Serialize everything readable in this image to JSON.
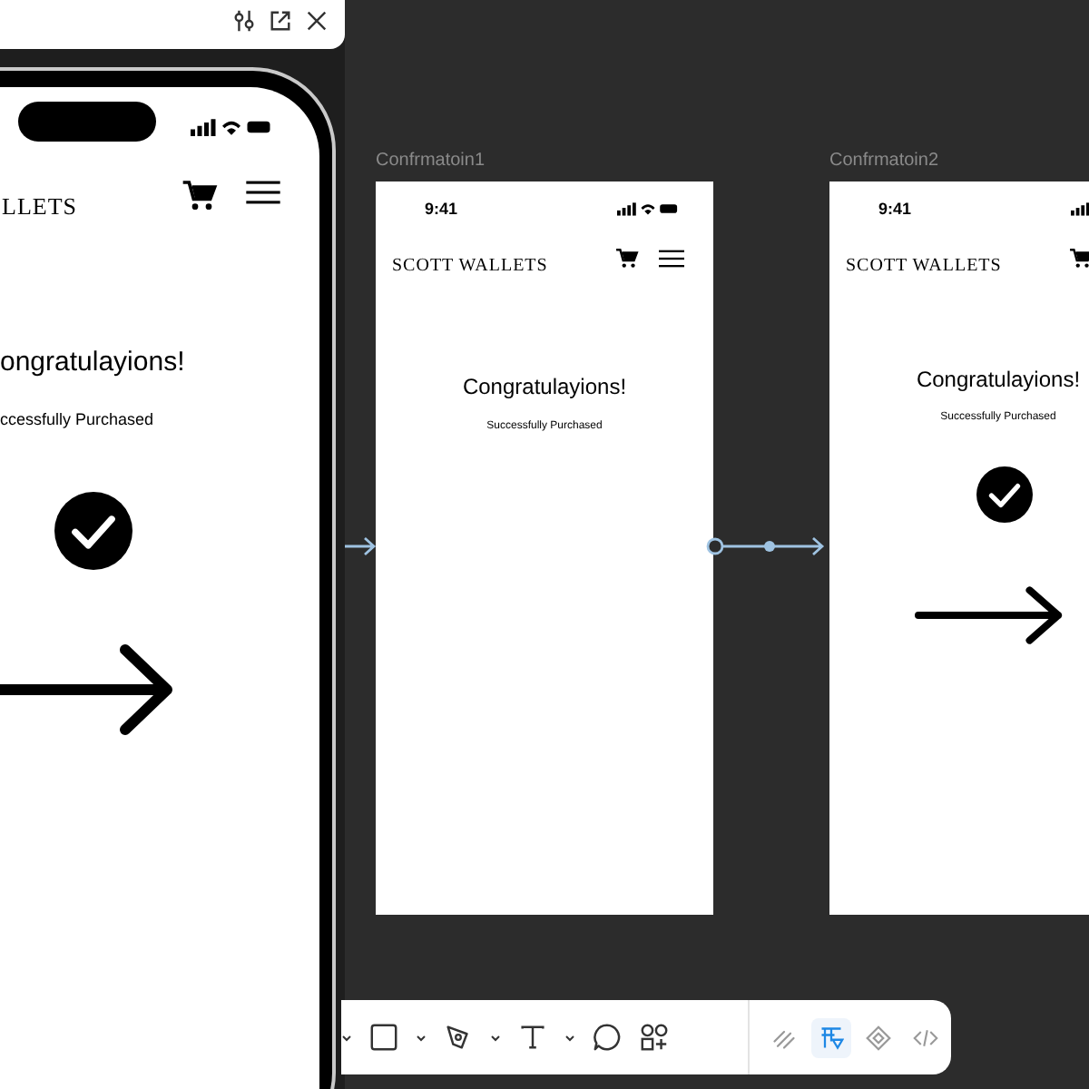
{
  "frames": [
    {
      "title": "Confrmatoin1",
      "time": "9:41",
      "brand": "SCOTT WALLETS",
      "heading": "Congratulayions!",
      "subtext": "Successfully Purchased",
      "header_icons": [
        {
          "kind": "cart"
        },
        {
          "kind": "menu"
        }
      ]
    },
    {
      "title": "Confrmatoin2",
      "time": "9:41",
      "brand": "SCOTT WALLETS",
      "heading": "Congratulayions!",
      "subtext": "Successfully Purchased",
      "header_icons": [
        {
          "kind": "cart"
        }
      ],
      "content": [
        {
          "kind": "check"
        },
        {
          "kind": "arrow"
        }
      ]
    }
  ],
  "preview": {
    "brand": "LLETS",
    "heading": "ongratulayions!",
    "subtext": "ccessfully Purchased"
  },
  "toolbar": {
    "tools": [
      {
        "kind": "caret"
      },
      {
        "kind": "rectangle"
      },
      {
        "kind": "caret"
      },
      {
        "kind": "pen"
      },
      {
        "kind": "caret"
      },
      {
        "kind": "text"
      },
      {
        "kind": "caret"
      },
      {
        "kind": "comment"
      },
      {
        "kind": "components"
      }
    ],
    "modes": [
      {
        "kind": "draw",
        "selected": false
      },
      {
        "kind": "design",
        "selected": true
      },
      {
        "kind": "prototype",
        "selected": false
      },
      {
        "kind": "dev",
        "selected": false
      }
    ]
  }
}
